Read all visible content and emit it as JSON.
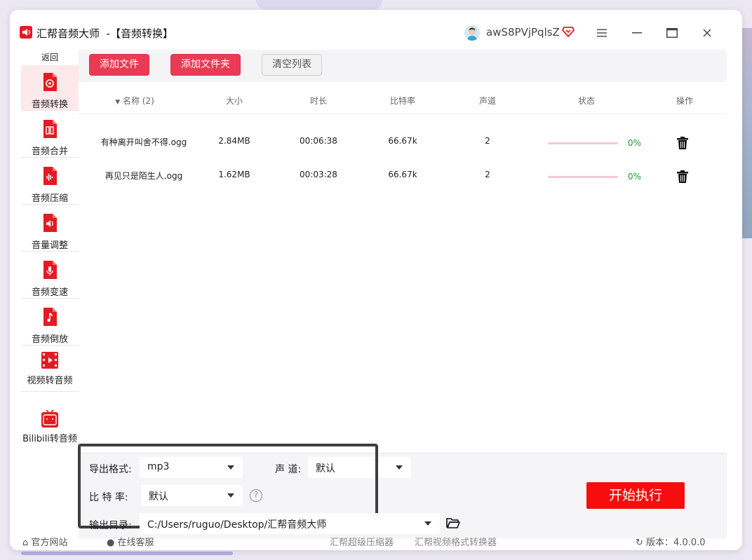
{
  "app": {
    "title": "汇帮音频大师  -【音频转换】",
    "username": "awS8PVjPqlsZ"
  },
  "window_controls": [
    "menu-icon",
    "minimize-icon",
    "maximize-icon",
    "close-icon"
  ],
  "sidebar": {
    "back_label": "返回",
    "items": [
      {
        "label": "音频转换",
        "icon": "audio-convert-icon",
        "active": true
      },
      {
        "label": "音频合并",
        "icon": "audio-merge-icon"
      },
      {
        "label": "音频压缩",
        "icon": "audio-compress-icon"
      },
      {
        "label": "音量调整",
        "icon": "volume-icon"
      },
      {
        "label": "音频变速",
        "icon": "microphone-icon"
      },
      {
        "label": "音频倒放",
        "icon": "music-note-icon"
      },
      {
        "label": "视频转音频",
        "icon": "video-icon"
      },
      {
        "label": "Bilibili转音频",
        "icon": "bilibili-icon"
      }
    ]
  },
  "toolbar": {
    "add_file": "添加文件",
    "add_folder": "添加文件夹",
    "clear_list": "清空列表"
  },
  "table": {
    "headers": {
      "name": "名称 (2)",
      "size": "大小",
      "duration": "时长",
      "bitrate": "比特率",
      "channels": "声道",
      "status": "状态",
      "actions": "操作"
    },
    "rows": [
      {
        "name": "有种离开叫舍不得.ogg",
        "size": "2.84MB",
        "duration": "00:06:38",
        "bitrate": "66.67k",
        "channels": "2",
        "progress": "0%"
      },
      {
        "name": "再见只是陌生人.ogg",
        "size": "1.62MB",
        "duration": "00:03:28",
        "bitrate": "66.67k",
        "channels": "2",
        "progress": "0%"
      }
    ]
  },
  "settings": {
    "format_label": "导出格式:",
    "format_value": "mp3",
    "channel_label": "声 道:",
    "channel_value": "默认",
    "bitrate_label": "比 特 率:",
    "bitrate_value": "默认",
    "output_label": "输出目录:",
    "output_value": "C:/Users/ruguo/Desktop/汇帮音频大师",
    "start_button": "开始执行"
  },
  "footer": {
    "website": "官方网站",
    "support": "在线客服",
    "link1": "汇帮超级压缩器",
    "link2": "汇帮视频格式转换器",
    "version": "版本：4.0.0.0"
  },
  "colors": {
    "accent": "#e93b54",
    "start": "#f60d0d",
    "progress_text": "#1a9a2a",
    "active_sidebar": "#fde8ea"
  }
}
